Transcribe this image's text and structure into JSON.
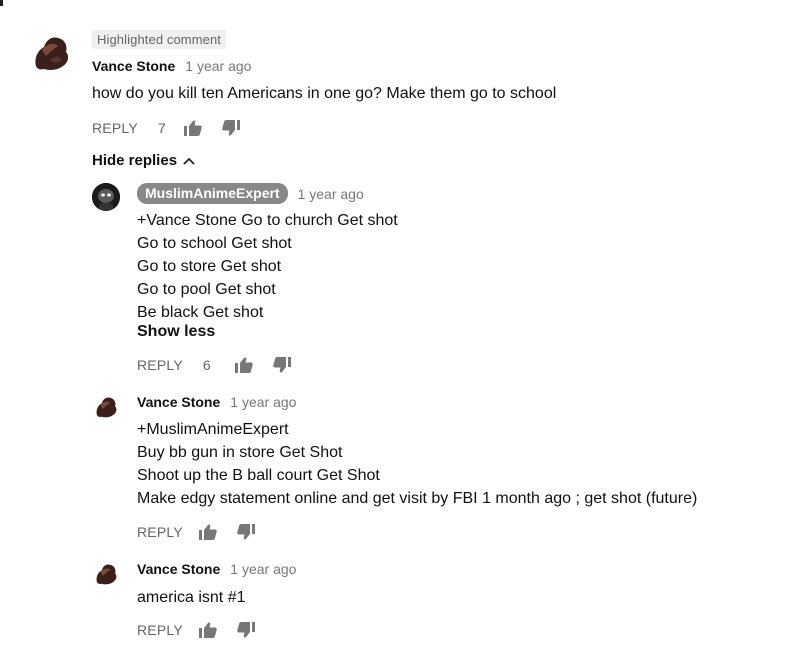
{
  "highlight_label": "Highlighted comment",
  "hide_replies_label": "Hide replies",
  "reply_label": "REPLY",
  "icons": {
    "like": "thumbs-up-icon",
    "dislike": "thumbs-down-icon",
    "chevron": "chevron-up-icon"
  },
  "colors": {
    "author_chip_bg": "#888888",
    "badge_bg": "#f0f0f0",
    "meta_text": "#777777"
  },
  "comment": {
    "author": "Vance Stone",
    "time": "1 year ago",
    "text": "how do you kill ten Americans in one go? Make them go to school",
    "likes": "7"
  },
  "replies": [
    {
      "author": "MuslimAnimeExpert",
      "time": "1 year ago",
      "lines": [
        "+Vance Stone Go to church Get shot",
        "Go to school Get shot",
        "Go to store Get shot",
        "Go to pool Get shot",
        "Be black Get shot"
      ],
      "show_less": "Show less",
      "likes": "6"
    },
    {
      "author": "Vance Stone",
      "time": "1 year ago",
      "lines": [
        "+MuslimAnimeExpert",
        "Buy bb gun in store Get Shot",
        "Shoot up the B ball court Get Shot",
        "Make edgy statement online and get visit by FBI 1 month ago ; get shot (future)"
      ]
    },
    {
      "author": "Vance Stone",
      "time": "1 year ago",
      "lines": [
        "america isnt #1"
      ]
    }
  ]
}
